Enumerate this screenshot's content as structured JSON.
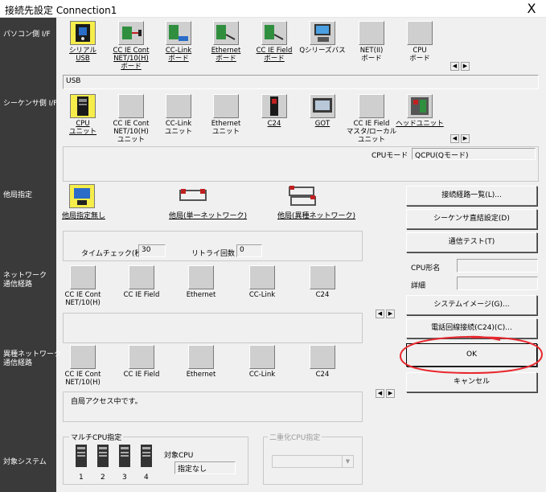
{
  "window": {
    "title": "接続先設定 Connection1",
    "close": "X"
  },
  "sections": {
    "pc_side": "パソコン側 I/F",
    "plc_side": "シーケンサ側 I/F",
    "other_station": "他局指定",
    "network_route": "ネットワーク\n通信経路",
    "hetero_network_route": "異種ネットワーク\n通信経路",
    "target_system": "対象システム"
  },
  "pc_interfaces": [
    {
      "label": "シリアル\nUSB"
    },
    {
      "label": "CC IE Cont\nNET/10(H)\nボード"
    },
    {
      "label": "CC-Link\nボード"
    },
    {
      "label": "Ethernet\nボード"
    },
    {
      "label": "CC IE Field\nボード"
    },
    {
      "label": "Qシリーズバス"
    },
    {
      "label": "NET(II)\nボード"
    },
    {
      "label": "CPU\nボード"
    }
  ],
  "pc_selected_value": "USB",
  "plc_interfaces": [
    {
      "label": "CPU\nユニット"
    },
    {
      "label": "CC IE Cont\nNET/10(H)\nユニット"
    },
    {
      "label": "CC-Link\nユニット"
    },
    {
      "label": "Ethernet\nユニット"
    },
    {
      "label": "C24"
    },
    {
      "label": "GOT"
    },
    {
      "label": "CC IE Field\nマスタ/ローカル\nユニット"
    },
    {
      "label": "ヘッドユニット"
    }
  ],
  "cpu_mode": {
    "label": "CPUモード",
    "value": "QCPU(Qモード)"
  },
  "other_station": [
    {
      "label": "他局指定無し"
    },
    {
      "label": "他局(単一ネットワーク)"
    },
    {
      "label": "他局(異種ネットワーク)"
    }
  ],
  "timing": {
    "time_check_label": "タイムチェック(秒)",
    "time_check_value": "30",
    "retry_label": "リトライ回数",
    "retry_value": "0"
  },
  "network_routes": [
    {
      "label": "CC IE Cont\nNET/10(H)"
    },
    {
      "label": "CC IE Field"
    },
    {
      "label": "Ethernet"
    },
    {
      "label": "CC-Link"
    },
    {
      "label": "C24"
    }
  ],
  "hetero_routes": [
    {
      "label": "CC IE Cont\nNET/10(H)"
    },
    {
      "label": "CC IE Field"
    },
    {
      "label": "Ethernet"
    },
    {
      "label": "CC-Link"
    },
    {
      "label": "C24"
    }
  ],
  "status_text": "自局アクセス中です。",
  "multi_cpu": {
    "title": "マルチCPU指定",
    "cpus": [
      "1",
      "2",
      "3",
      "4"
    ],
    "target_label": "対象CPU",
    "target_value": "指定なし"
  },
  "redundant": {
    "title": "二重化CPU指定"
  },
  "cpu_info": {
    "model_label": "CPU形名",
    "detail_label": "詳細"
  },
  "buttons": {
    "route_list": "接続経路一覧(L)...",
    "direct": "シーケンサ直結設定(D)",
    "comm_test": "通信テスト(T)",
    "system_image": "システムイメージ(G)...",
    "phone": "電話回線接続(C24)(C)...",
    "ok": "OK",
    "cancel": "キャンセル"
  },
  "annotation_color": "#e8282e"
}
